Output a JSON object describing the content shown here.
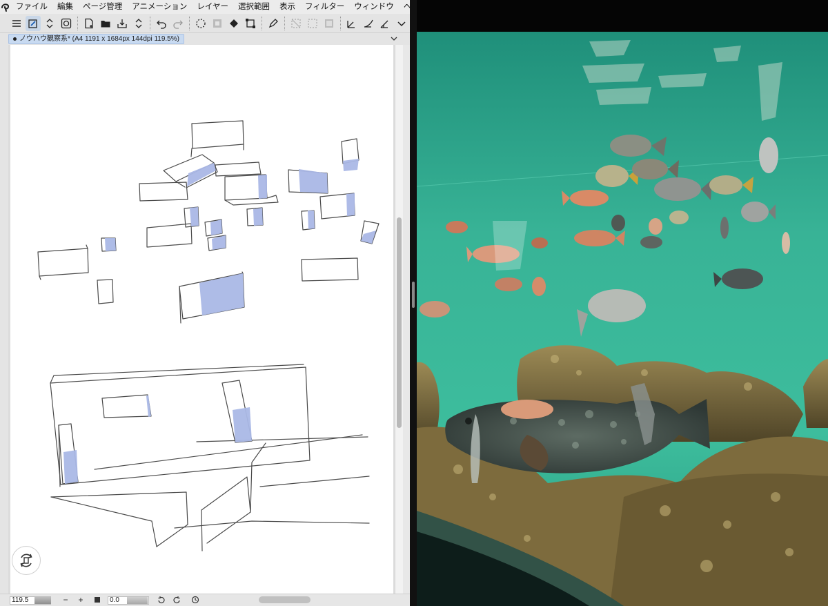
{
  "menubar": {
    "logo_icon": "clip-studio-logo-icon",
    "items": [
      "ファイル",
      "編集",
      "ページ管理",
      "アニメーション",
      "レイヤー",
      "選択範囲",
      "表示",
      "フィルター",
      "ウィンドウ",
      "ヘ"
    ]
  },
  "toolbar": {
    "buttons": [
      "menu-icon",
      "sub-view-icon",
      "stepper-icon",
      "navigator-icon",
      "new-file-icon",
      "open-icon",
      "save-icon",
      "save-stepper-icon",
      "undo-icon",
      "redo-icon",
      "clear-icon",
      "clear-outside-icon",
      "fill-icon",
      "transform-icon",
      "pen-icon",
      "hide-selection-icon",
      "selection-launcher-icon",
      "ruler-icon",
      "snap-ruler-icon",
      "snap-special-ruler-icon",
      "snap-grid-icon",
      "more-chevron-icon"
    ]
  },
  "document_tab": {
    "label": "ノウハウ観察系* (A4 1191 x 1684px 144dpi 119.5%)"
  },
  "statusbar": {
    "zoom": "119.5",
    "zoom_out": "−",
    "zoom_in": "+",
    "angle": "0.0"
  },
  "colors": {
    "accent_tab": "#c8daf1",
    "sketch_fill": "#aab8e6",
    "sketch_line": "#4a4a4a",
    "water": "#2fae8f"
  },
  "photo": {
    "subject": "aquarium-photo"
  }
}
